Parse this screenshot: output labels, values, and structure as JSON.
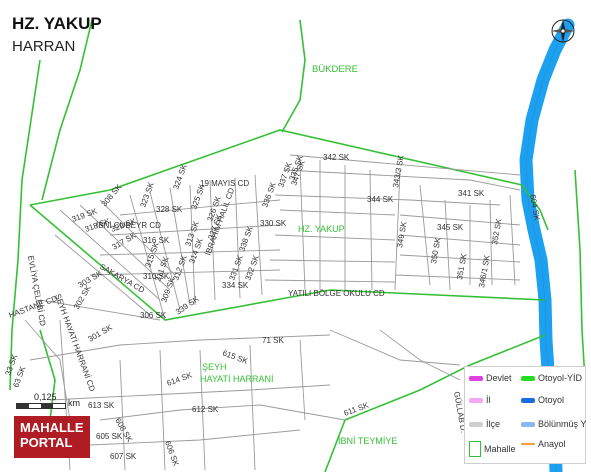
{
  "map": {
    "title": "HZ. YAKUP",
    "subtitle": "HARRAN",
    "district_labels": [
      "BÜKDERE",
      "HZ. YAKUP",
      "ŞEYH",
      "HAYATİ HARRANİ",
      "İBNİ TEYMİYE"
    ],
    "street_labels": [
      "342 SK",
      "341 SK",
      "344 SK",
      "345 SK",
      "347 SK",
      "337 SK",
      "336 SK",
      "330 SK",
      "335 SK",
      "343/3 SK",
      "349 SK",
      "350 SK",
      "351 SK",
      "346/1 SK",
      "352 SK",
      "19 MAYIS CD",
      "328 SK",
      "329 SK",
      "324 SK",
      "325 SK",
      "323 SK",
      "326 SK",
      "327 SK",
      "319 SK",
      "318 SK",
      "317 SK",
      "316 SK",
      "315 SK",
      "314 SK",
      "313 SK",
      "312 SK",
      "311 SK",
      "310 SK",
      "309 SK",
      "308 SK",
      "306 SK",
      "303 SK",
      "302 SK",
      "301 SK",
      "İBNİ CUBEYR CD",
      "İBRAHİM HALİL CD",
      "SAKARYA CD",
      "YATILI BÖLGE OKULU CD",
      "331 SK",
      "332 SK",
      "334 SK",
      "338 SK",
      "339 SK",
      "EVLİYA ÇELEBİ CD",
      "ŞEYH HAYATİ HARRANİ CD",
      "HASTANE CD",
      "33 SK",
      "63 SK",
      "71 SK",
      "615 SK",
      "614 SK",
      "612 SK",
      "613 SK",
      "608 SK",
      "605 SK",
      "607 SK",
      "606 SK",
      "611 SK",
      "604 SK",
      "GÜLLAB D.",
      "ASLAN"
    ],
    "scale": {
      "value": "0,125",
      "unit": "km"
    },
    "brand": {
      "line1": "MAHALLE",
      "line2": "PORTAL"
    },
    "legend": {
      "items": [
        {
          "label": "Devlet",
          "color": "#e040e0"
        },
        {
          "label": "Otoyol-YİD",
          "color": "#22dd22"
        },
        {
          "label": "İl",
          "color": "#f0a8f0"
        },
        {
          "label": "Otoyol",
          "color": "#1a6ee0"
        },
        {
          "label": "İlçe",
          "color": "#cfcfcf"
        },
        {
          "label": "Bölünmüş Y",
          "color": "#8ab8f0"
        },
        {
          "label": "Mahalle",
          "color": "#35c035"
        },
        {
          "label": "Anayol",
          "color": "#f0a040"
        }
      ]
    },
    "colors": {
      "highway": "#1ca0f0",
      "boundary": "#35c035",
      "street": "#9a9a9a",
      "brand": "#b01c24"
    },
    "icons": {
      "compass": "compass-rose-icon",
      "scale": "scale-bar-icon"
    }
  }
}
